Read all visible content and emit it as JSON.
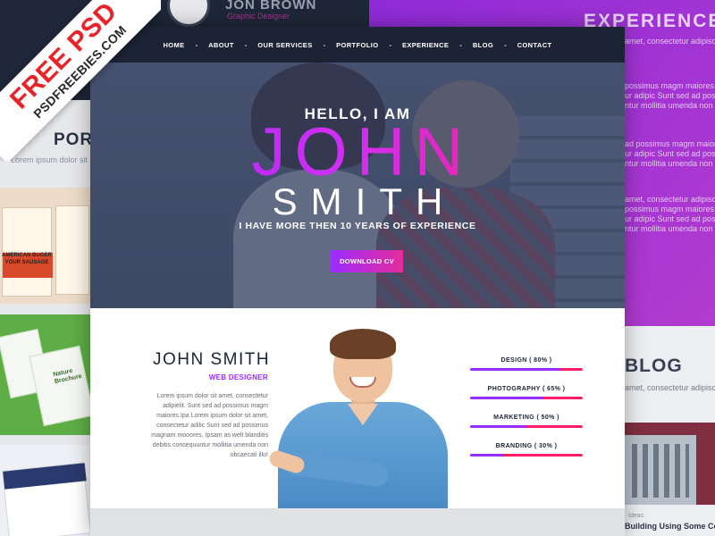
{
  "badge": {
    "title": "FREE PSD",
    "site": "PSDFREEBIES.COM"
  },
  "background": {
    "top_name": "JON BROWN",
    "top_role": "Graphic Designer",
    "portfolio_title": "PORTFOLIO",
    "portfolio_text": "Lorem ipsum dolor sit amet",
    "burger_text": "AMERICAN BUGER YOUR SAUSAGE",
    "nature_text": "Nature Brochure",
    "experience_title": "EXPERIENCE",
    "experience_lines": [
      "amet, consectetur adipiscing",
      "possimus magm maiores.Ip",
      "ur adipic Sunt sed ad posi",
      "ntur mollitia umenda non ebr",
      "ad possimus magm maiores.Ip",
      "ur adipic Sunt sed ad posi",
      "ntur mollitia umenda non ebr",
      "amet, consectetur adipiscing",
      "possimus magm maiores.Ip",
      "ur adipic Sunt sed ad posi",
      "ntur mollitia umenda non ebr"
    ],
    "blog_title": "BLOG",
    "blog_text": "amet, consectetur adipiscing",
    "blog_caption": "Building Using Some Color",
    "blog_tag": "Ideas"
  },
  "nav": {
    "items": [
      "HOME",
      "ABOUT",
      "OUR SERVICES",
      "PORTFOLIO",
      "EXPERIENCE",
      "BLOG",
      "CONTACT"
    ],
    "separator": "-"
  },
  "hero": {
    "greeting": "HELLO, I AM",
    "first_name": "JOHN",
    "last_name": "SMITH",
    "tagline": "I HAVE MORE THEN 10 YEARS OF EXPERIENCE",
    "cta_label": "DOWNLOAD CV"
  },
  "about": {
    "name": "JOHN SMITH",
    "role": "WEB DESIGNER",
    "bio": "Lorem ipsum dolor sit amet, consectetur adipielit. Sunt sed ad possimus magm maiores.Ipa Lorem ipsum dolor sit amet, consectetur adilic Sunt sed ad possimus magnam mooores. Ipsam as welt blanditis debitis consequuntur mollitia umenda non obcaecati illo!"
  },
  "skills": [
    {
      "label": "DESIGN ( 80% )",
      "percent": 80
    },
    {
      "label": "PHOTOGRAPHY ( 65% )",
      "percent": 65
    },
    {
      "label": "MARKETING ( 50% )",
      "percent": 50
    },
    {
      "label": "BRANDING ( 30% )",
      "percent": 30
    }
  ],
  "colors": {
    "nav_bg": "#1b2334",
    "accent_purple": "#9a2cff",
    "accent_pink": "#ff1d6b",
    "badge_red": "#e8232a"
  }
}
